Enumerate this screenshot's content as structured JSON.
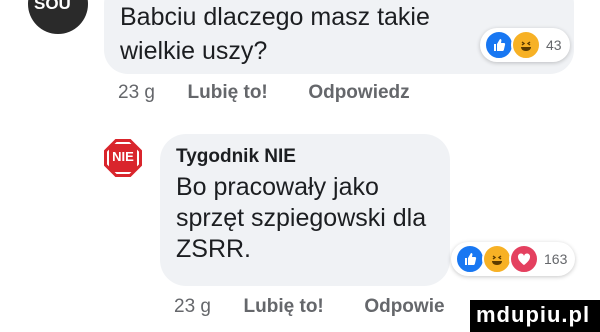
{
  "comment1": {
    "avatar_text": "SOU",
    "text": "Babciu dlaczego masz takie wielkie uszy?",
    "reaction_count": "43",
    "time": "23 g",
    "like": "Lubię to!",
    "reply": "Odpowiedz"
  },
  "comment2": {
    "avatar_text": "NIE",
    "author": "Tygodnik NIE",
    "text": "Bo pracowały jako sprzęt szpiegowski dla ZSRR.",
    "reaction_count": "163",
    "time": "23 g",
    "like": "Lubię to!",
    "reply": "Odpowie"
  },
  "watermark": "mdupiu.pl",
  "icons": [
    "like-icon",
    "haha-icon",
    "wow-icon",
    "stop-sign-icon"
  ],
  "colors": {
    "like": "#1877f2",
    "haha": "#f7b125",
    "wow": "#e4405f",
    "nie": "#d9252c"
  }
}
